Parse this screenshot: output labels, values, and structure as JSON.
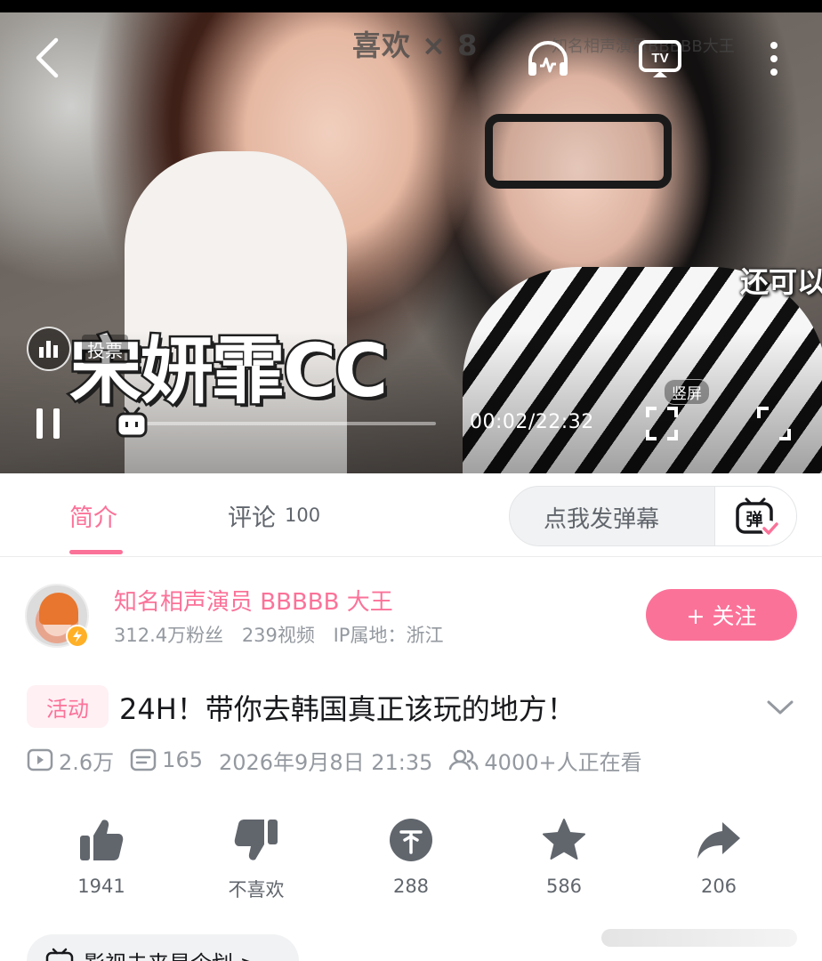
{
  "player": {
    "like_multiplier": "喜欢 × 8",
    "uploader_watermark": "知名相声演员BBBBB大王",
    "subtitle_right": "还可以",
    "big_caption": "宋妍霏CC",
    "vote_label": "投票",
    "time": "00:02/22:32",
    "vertical_label": "竖屏",
    "progress": 0.0015
  },
  "tabs": {
    "intro": "简介",
    "comments": "评论",
    "comments_count": "100",
    "danmaku_placeholder": "点我发弹幕",
    "danmaku_button": "弹"
  },
  "uploader": {
    "name": "知名相声演员 BBBBB 大王",
    "followers": "312.4万粉丝",
    "videos": "239视频",
    "ip": "IP属地：浙江",
    "follow_label": "+ 关注"
  },
  "video": {
    "tag": "活动",
    "title": "24H！带你去韩国真正该玩的地方！",
    "views": "2.6万",
    "danmaku_count": "165",
    "datetime": "2026年9月8日 21:35",
    "watching": "4000+人正在看"
  },
  "actions": {
    "like": "1941",
    "dislike": "不喜欢",
    "coin": "288",
    "favorite": "586",
    "share": "206"
  },
  "bottom": {
    "project_chip": "影视未来星企划 >"
  },
  "colors": {
    "accent": "#fb7299",
    "text_secondary": "#9499a0",
    "icon": "#61666d"
  }
}
